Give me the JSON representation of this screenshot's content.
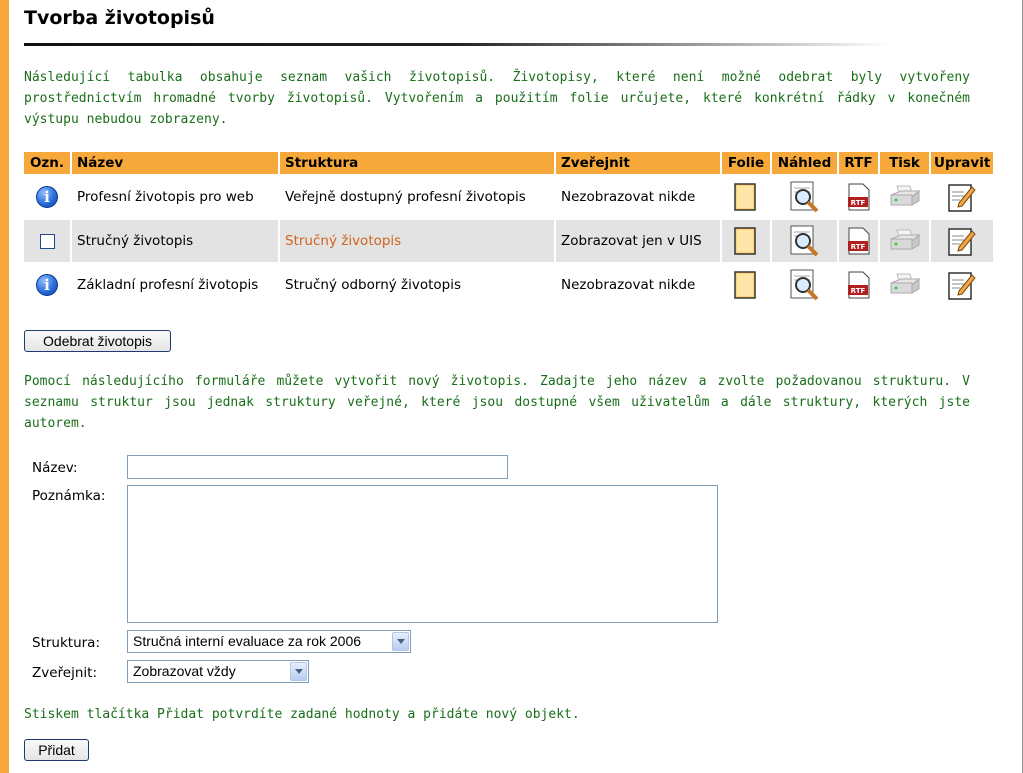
{
  "page": {
    "title": "Tvorba životopisů",
    "intro": "Následující tabulka obsahuje seznam vašich životopisů. Životopisy, které není možné odebrat byly vytvořeny prostřednictvím hromadné tvorby životopisů. Vytvořením a použitím folie určujete, které konkrétní řádky v konečném výstupu nebudou zobrazeny.",
    "form_intro": "Pomocí následujícího formuláře můžete vytvořit nový životopis. Zadajte jeho název a zvolte požadovanou strukturu. V seznamu struktur jsou jednak struktury veřejné, které jsou dostupné všem uživatelům a dále struktury, kterých jste autorem.",
    "submit_hint": "Stiskem tlačítka Přidat potvrdíte zadané hodnoty a přidáte nový objekt."
  },
  "table": {
    "headers": {
      "mark": "Ozn.",
      "name": "Název",
      "structure": "Struktura",
      "publish": "Zveřejnit",
      "folie": "Folie",
      "preview": "Náhled",
      "rtf": "RTF",
      "print": "Tisk",
      "edit": "Upravit"
    },
    "rows": [
      {
        "mark": "info-icon",
        "name": "Profesní životopis pro web",
        "structure": "Veřejně dostupný profesní životopis",
        "publish": "Nezobrazovat nikde"
      },
      {
        "mark": "checkbox",
        "name": "Stručný životopis",
        "structure": "Stručný životopis",
        "publish": "Zobrazovat jen v UIS"
      },
      {
        "mark": "info-icon",
        "name": "Základní profesní životopis",
        "structure": "Stručný odborný životopis",
        "publish": "Nezobrazovat nikde"
      }
    ]
  },
  "buttons": {
    "remove": "Odebrat životopis",
    "add": "Přidat"
  },
  "form": {
    "name_label": "Název:",
    "name_value": "",
    "note_label": "Poznámka:",
    "note_value": "",
    "structure_label": "Struktura:",
    "structure_selected": "Stručná interní evaluace za rok 2006",
    "publish_label": "Zveřejnit:",
    "publish_selected": "Zobrazovat vždy"
  },
  "colors": {
    "accent": "#f6a93a",
    "text_green": "#1a6e1a",
    "link_orange": "#d2631e",
    "row_shade": "#e3e3e3"
  }
}
